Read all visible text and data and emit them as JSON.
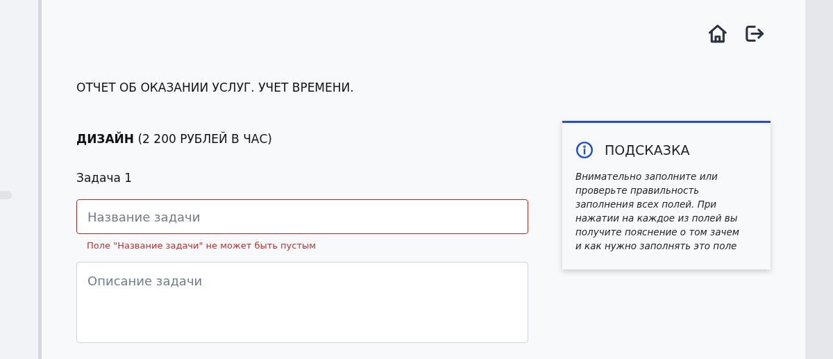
{
  "header": {
    "icons": [
      {
        "kind": "home"
      },
      {
        "kind": "logout"
      }
    ]
  },
  "page_title": "ОТЧЕТ ОБ ОКАЗАНИИ УСЛУГ. УЧЕТ ВРЕМЕНИ.",
  "section": {
    "heading": "**ДИЗАЙН** (2 200 РУБЛЕЙ В ЧАС)",
    "task_label": "Задача 1",
    "fields": [
      {
        "kind": "input",
        "placeholder": "Название задачи",
        "invalid": true,
        "error": "Поле \"Название задачи\" не может быть пустым"
      },
      {
        "kind": "textarea",
        "placeholder": "Описание задачи",
        "invalid": false
      }
    ]
  },
  "hint": {
    "title": "ПОДСКАЗКА",
    "text": "Внимательно заполните или проверьте правильность заполнения всех полей. При нажатии на каждое из полей вы получите пояснение о том зачем и как нужно заполнять это поле"
  }
}
